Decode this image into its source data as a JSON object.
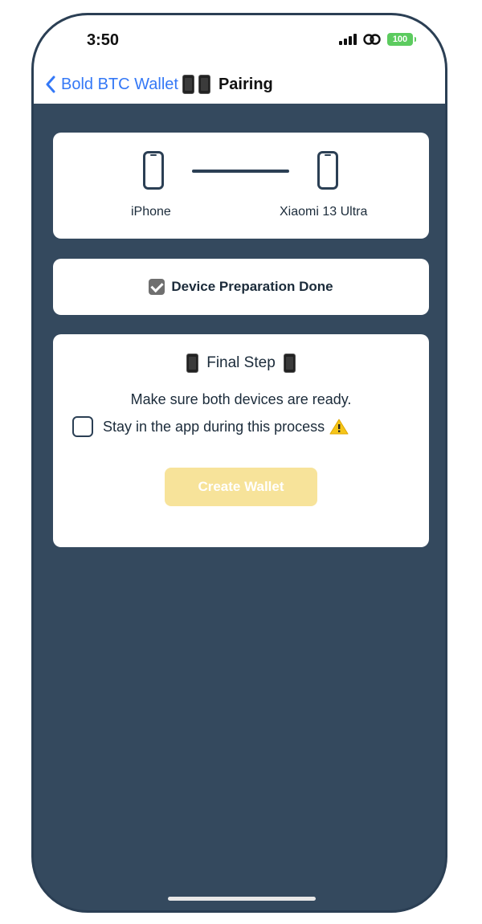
{
  "status_bar": {
    "time": "3:50",
    "battery": "100"
  },
  "nav": {
    "back_label": "Bold BTC Wallet",
    "title": "Pairing"
  },
  "pairing": {
    "device_left": "iPhone",
    "device_right": "Xiaomi 13 Ultra"
  },
  "preparation": {
    "label": "Device Preparation Done"
  },
  "final_step": {
    "title": "Final Step",
    "message": "Make sure both devices are ready.",
    "stay_label": "Stay in the app during this process",
    "create_button": "Create Wallet"
  },
  "colors": {
    "background": "#34495e",
    "accent": "#3478f6",
    "button_disabled": "#f7e39a",
    "battery": "#5ccb5f"
  }
}
